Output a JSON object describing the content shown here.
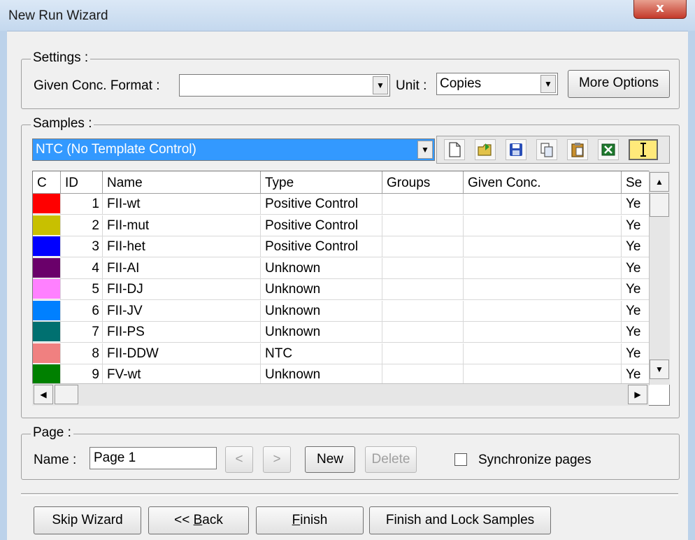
{
  "window": {
    "title": "New Run Wizard",
    "close_glyph": "x"
  },
  "settings": {
    "group_label": "Settings :",
    "given_conc_label": "Given Conc. Format :",
    "given_conc_value": "",
    "unit_label": "Unit :",
    "unit_value": "Copies",
    "more_options_label": "More Options"
  },
  "samples": {
    "group_label": "Samples :",
    "type_selector_value": "NTC (No Template Control)",
    "toolbar_icons": [
      "new-document-icon",
      "open-folder-icon",
      "save-icon",
      "copy-icon",
      "paste-icon",
      "excel-export-icon",
      "edit-text-icon"
    ],
    "columns": [
      "C",
      "ID",
      "Name",
      "Type",
      "Groups",
      "Given Conc.",
      "Se"
    ],
    "rows": [
      {
        "color": "#ff0000",
        "id": "1",
        "name": "FII-wt",
        "type": "Positive Control",
        "groups": "",
        "given_conc": "",
        "se": "Ye"
      },
      {
        "color": "#c8c000",
        "id": "2",
        "name": "FII-mut",
        "type": "Positive Control",
        "groups": "",
        "given_conc": "",
        "se": "Ye"
      },
      {
        "color": "#0000ff",
        "id": "3",
        "name": "FII-het",
        "type": "Positive Control",
        "groups": "",
        "given_conc": "",
        "se": "Ye"
      },
      {
        "color": "#6a006a",
        "id": "4",
        "name": "FII-AI",
        "type": "Unknown",
        "groups": "",
        "given_conc": "",
        "se": "Ye"
      },
      {
        "color": "#ff80ff",
        "id": "5",
        "name": "FII-DJ",
        "type": "Unknown",
        "groups": "",
        "given_conc": "",
        "se": "Ye"
      },
      {
        "color": "#0080ff",
        "id": "6",
        "name": "FII-JV",
        "type": "Unknown",
        "groups": "",
        "given_conc": "",
        "se": "Ye"
      },
      {
        "color": "#007070",
        "id": "7",
        "name": "FII-PS",
        "type": "Unknown",
        "groups": "",
        "given_conc": "",
        "se": "Ye"
      },
      {
        "color": "#f08080",
        "id": "8",
        "name": "FII-DDW",
        "type": "NTC",
        "groups": "",
        "given_conc": "",
        "se": "Ye"
      },
      {
        "color": "#008000",
        "id": "9",
        "name": "FV-wt",
        "type": "Unknown",
        "groups": "",
        "given_conc": "",
        "se": "Ye"
      }
    ]
  },
  "page": {
    "group_label": "Page :",
    "name_label": "Name :",
    "name_value": "Page 1",
    "prev_label": "<",
    "next_label": ">",
    "new_label": "New",
    "delete_label": "Delete",
    "sync_label": "Synchronize pages",
    "sync_checked": false
  },
  "footer": {
    "skip_label": "Skip Wizard",
    "back_prefix": "<< ",
    "back_mnemonic": "B",
    "back_rest": "ack",
    "finish_mnemonic": "F",
    "finish_rest": "inish",
    "finish_lock_label": "Finish and Lock Samples"
  }
}
